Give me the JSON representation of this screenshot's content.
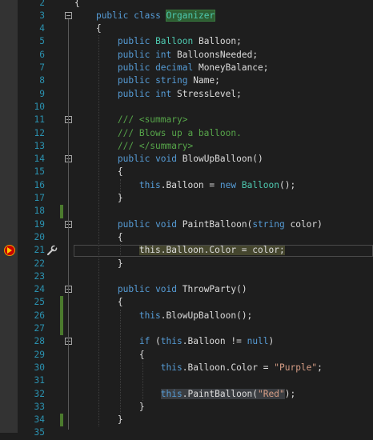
{
  "editor": {
    "language": "csharp",
    "breakpoint_line": 21,
    "changed_lines": [
      18,
      25,
      26,
      27,
      34
    ]
  },
  "lines": [
    {
      "n": "2",
      "fold": false,
      "tokens": [
        {
          "t": "{",
          "c": "pl"
        }
      ]
    },
    {
      "n": "3",
      "fold": true,
      "tokens": [
        {
          "t": "    ",
          "c": "pl"
        },
        {
          "t": "public",
          "c": "kw"
        },
        {
          "t": " ",
          "c": "pl"
        },
        {
          "t": "class",
          "c": "kw"
        },
        {
          "t": " ",
          "c": "pl"
        },
        {
          "t": "Organizer",
          "c": "cls-hl"
        }
      ]
    },
    {
      "n": "4",
      "fold": false,
      "tokens": [
        {
          "t": "    {",
          "c": "pl"
        }
      ]
    },
    {
      "n": "5",
      "fold": false,
      "tokens": [
        {
          "t": "        ",
          "c": "pl"
        },
        {
          "t": "public",
          "c": "kw"
        },
        {
          "t": " ",
          "c": "pl"
        },
        {
          "t": "Balloon",
          "c": "ty"
        },
        {
          "t": " Balloon;",
          "c": "pl"
        }
      ]
    },
    {
      "n": "6",
      "fold": false,
      "tokens": [
        {
          "t": "        ",
          "c": "pl"
        },
        {
          "t": "public",
          "c": "kw"
        },
        {
          "t": " ",
          "c": "pl"
        },
        {
          "t": "int",
          "c": "kw"
        },
        {
          "t": " BalloonsNeeded;",
          "c": "pl"
        }
      ]
    },
    {
      "n": "7",
      "fold": false,
      "tokens": [
        {
          "t": "        ",
          "c": "pl"
        },
        {
          "t": "public",
          "c": "kw"
        },
        {
          "t": " ",
          "c": "pl"
        },
        {
          "t": "decimal",
          "c": "kw"
        },
        {
          "t": " MoneyBalance;",
          "c": "pl"
        }
      ]
    },
    {
      "n": "8",
      "fold": false,
      "tokens": [
        {
          "t": "        ",
          "c": "pl"
        },
        {
          "t": "public",
          "c": "kw"
        },
        {
          "t": " ",
          "c": "pl"
        },
        {
          "t": "string",
          "c": "kw"
        },
        {
          "t": " Name;",
          "c": "pl"
        }
      ]
    },
    {
      "n": "9",
      "fold": false,
      "tokens": [
        {
          "t": "        ",
          "c": "pl"
        },
        {
          "t": "public",
          "c": "kw"
        },
        {
          "t": " ",
          "c": "pl"
        },
        {
          "t": "int",
          "c": "kw"
        },
        {
          "t": " StressLevel;",
          "c": "pl"
        }
      ]
    },
    {
      "n": "10",
      "fold": false,
      "tokens": []
    },
    {
      "n": "11",
      "fold": true,
      "tokens": [
        {
          "t": "        ",
          "c": "pl"
        },
        {
          "t": "/// <summary>",
          "c": "cm"
        }
      ]
    },
    {
      "n": "12",
      "fold": false,
      "tokens": [
        {
          "t": "        ",
          "c": "pl"
        },
        {
          "t": "/// Blows up a balloon.",
          "c": "cm"
        }
      ]
    },
    {
      "n": "13",
      "fold": false,
      "tokens": [
        {
          "t": "        ",
          "c": "pl"
        },
        {
          "t": "/// </summary>",
          "c": "cm"
        }
      ]
    },
    {
      "n": "14",
      "fold": true,
      "tokens": [
        {
          "t": "        ",
          "c": "pl"
        },
        {
          "t": "public",
          "c": "kw"
        },
        {
          "t": " ",
          "c": "pl"
        },
        {
          "t": "void",
          "c": "kw"
        },
        {
          "t": " BlowUpBalloon()",
          "c": "pl"
        }
      ]
    },
    {
      "n": "15",
      "fold": false,
      "tokens": [
        {
          "t": "        {",
          "c": "pl"
        }
      ]
    },
    {
      "n": "16",
      "fold": false,
      "tokens": [
        {
          "t": "            ",
          "c": "pl"
        },
        {
          "t": "this",
          "c": "kw"
        },
        {
          "t": ".Balloon = ",
          "c": "pl"
        },
        {
          "t": "new",
          "c": "kw"
        },
        {
          "t": " ",
          "c": "pl"
        },
        {
          "t": "Balloon",
          "c": "ty"
        },
        {
          "t": "();",
          "c": "pl"
        }
      ]
    },
    {
      "n": "17",
      "fold": false,
      "tokens": [
        {
          "t": "        }",
          "c": "pl"
        }
      ]
    },
    {
      "n": "18",
      "fold": false,
      "tokens": []
    },
    {
      "n": "19",
      "fold": true,
      "tokens": [
        {
          "t": "        ",
          "c": "pl"
        },
        {
          "t": "public",
          "c": "kw"
        },
        {
          "t": " ",
          "c": "pl"
        },
        {
          "t": "void",
          "c": "kw"
        },
        {
          "t": " PaintBalloon(",
          "c": "pl"
        },
        {
          "t": "string",
          "c": "kw"
        },
        {
          "t": " color)",
          "c": "pl"
        }
      ]
    },
    {
      "n": "20",
      "fold": false,
      "tokens": [
        {
          "t": "        {",
          "c": "pl"
        }
      ]
    },
    {
      "n": "21",
      "fold": false,
      "tokens": [
        {
          "t": "            ",
          "c": "pl"
        },
        {
          "t": "this.Balloon.Color = color;",
          "c": "bp-hl"
        }
      ]
    },
    {
      "n": "22",
      "fold": false,
      "tokens": [
        {
          "t": "        }",
          "c": "pl"
        }
      ]
    },
    {
      "n": "23",
      "fold": false,
      "tokens": []
    },
    {
      "n": "24",
      "fold": true,
      "tokens": [
        {
          "t": "        ",
          "c": "pl"
        },
        {
          "t": "public",
          "c": "kw"
        },
        {
          "t": " ",
          "c": "pl"
        },
        {
          "t": "void",
          "c": "kw"
        },
        {
          "t": " ThrowParty()",
          "c": "pl"
        }
      ]
    },
    {
      "n": "25",
      "fold": false,
      "tokens": [
        {
          "t": "        {",
          "c": "pl"
        }
      ]
    },
    {
      "n": "26",
      "fold": false,
      "tokens": [
        {
          "t": "            ",
          "c": "pl"
        },
        {
          "t": "this",
          "c": "kw"
        },
        {
          "t": ".BlowUpBalloon();",
          "c": "pl"
        }
      ]
    },
    {
      "n": "27",
      "fold": false,
      "tokens": []
    },
    {
      "n": "28",
      "fold": true,
      "tokens": [
        {
          "t": "            ",
          "c": "pl"
        },
        {
          "t": "if",
          "c": "kw"
        },
        {
          "t": " (",
          "c": "pl"
        },
        {
          "t": "this",
          "c": "kw"
        },
        {
          "t": ".Balloon != ",
          "c": "pl"
        },
        {
          "t": "null",
          "c": "kw"
        },
        {
          "t": ")",
          "c": "pl"
        }
      ]
    },
    {
      "n": "29",
      "fold": false,
      "tokens": [
        {
          "t": "            {",
          "c": "pl"
        }
      ]
    },
    {
      "n": "30",
      "fold": false,
      "tokens": [
        {
          "t": "                ",
          "c": "pl"
        },
        {
          "t": "this",
          "c": "kw"
        },
        {
          "t": ".Balloon.Color = ",
          "c": "pl"
        },
        {
          "t": "\"Purple\"",
          "c": "str"
        },
        {
          "t": ";",
          "c": "pl"
        }
      ]
    },
    {
      "n": "31",
      "fold": false,
      "tokens": []
    },
    {
      "n": "32",
      "fold": false,
      "tokens": [
        {
          "t": "                ",
          "c": "pl"
        },
        {
          "t": "this",
          "c": "kw cur-hl"
        },
        {
          "t": ".PaintBalloon(",
          "c": "cur-hl"
        },
        {
          "t": "\"Red\"",
          "c": "str cur-hl"
        },
        {
          "t": ");",
          "c": "pl"
        }
      ]
    },
    {
      "n": "33",
      "fold": false,
      "tokens": [
        {
          "t": "            }",
          "c": "pl"
        }
      ]
    },
    {
      "n": "34",
      "fold": false,
      "tokens": [
        {
          "t": "        }",
          "c": "pl"
        }
      ]
    },
    {
      "n": "35",
      "fold": false,
      "tokens": []
    }
  ],
  "icons": {
    "exec_arrow": "current-statement-arrow-icon",
    "wrench": "quick-action-wrench-icon"
  }
}
